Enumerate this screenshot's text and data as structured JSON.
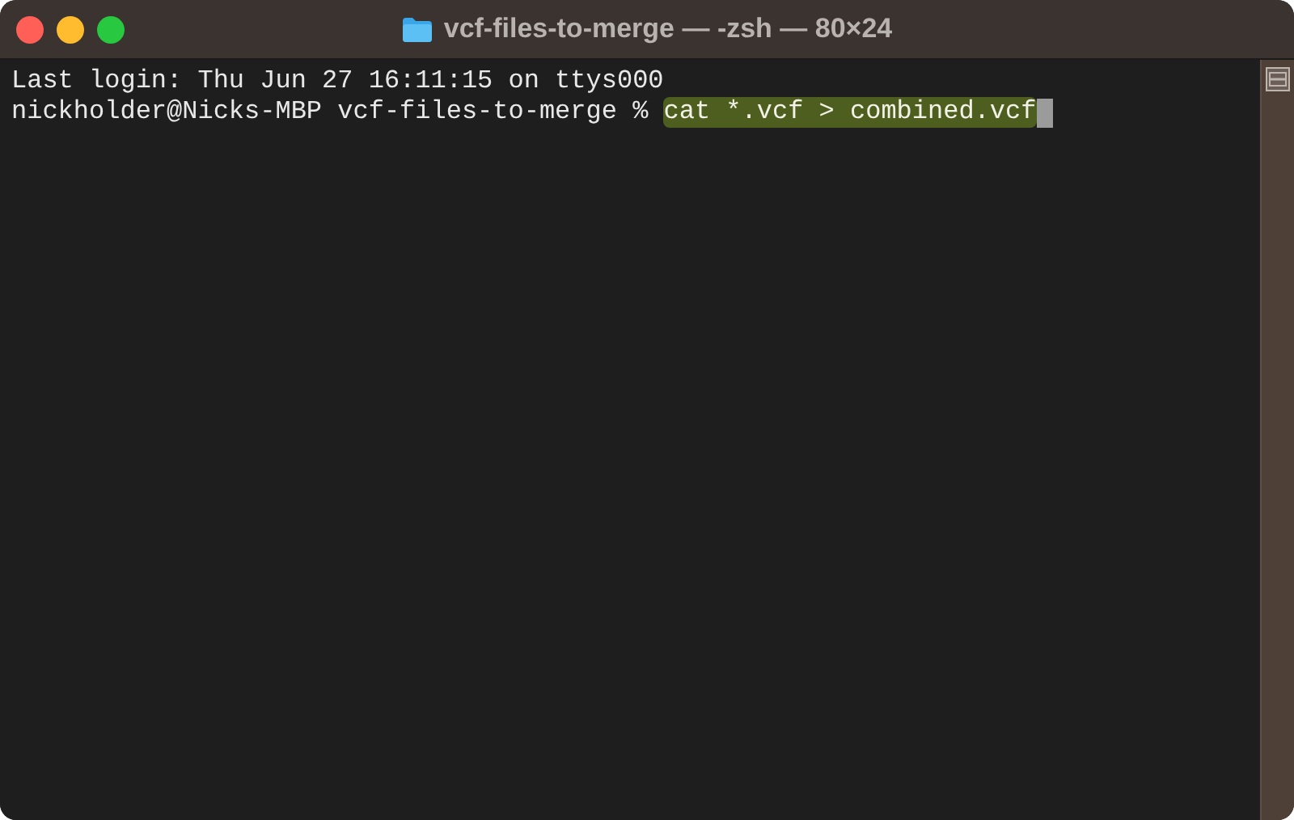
{
  "window": {
    "title": "vcf-files-to-merge — -zsh — 80×24"
  },
  "lines": [
    {
      "prompt": "Last login: Thu Jun 27 16:11:15 on ttys000"
    },
    {
      "prompt": "nickholder@Nicks-MBP vcf-files-to-merge % ",
      "command": "cat *.vcf > combined.vcf",
      "selected": true,
      "cursor": true
    }
  ]
}
